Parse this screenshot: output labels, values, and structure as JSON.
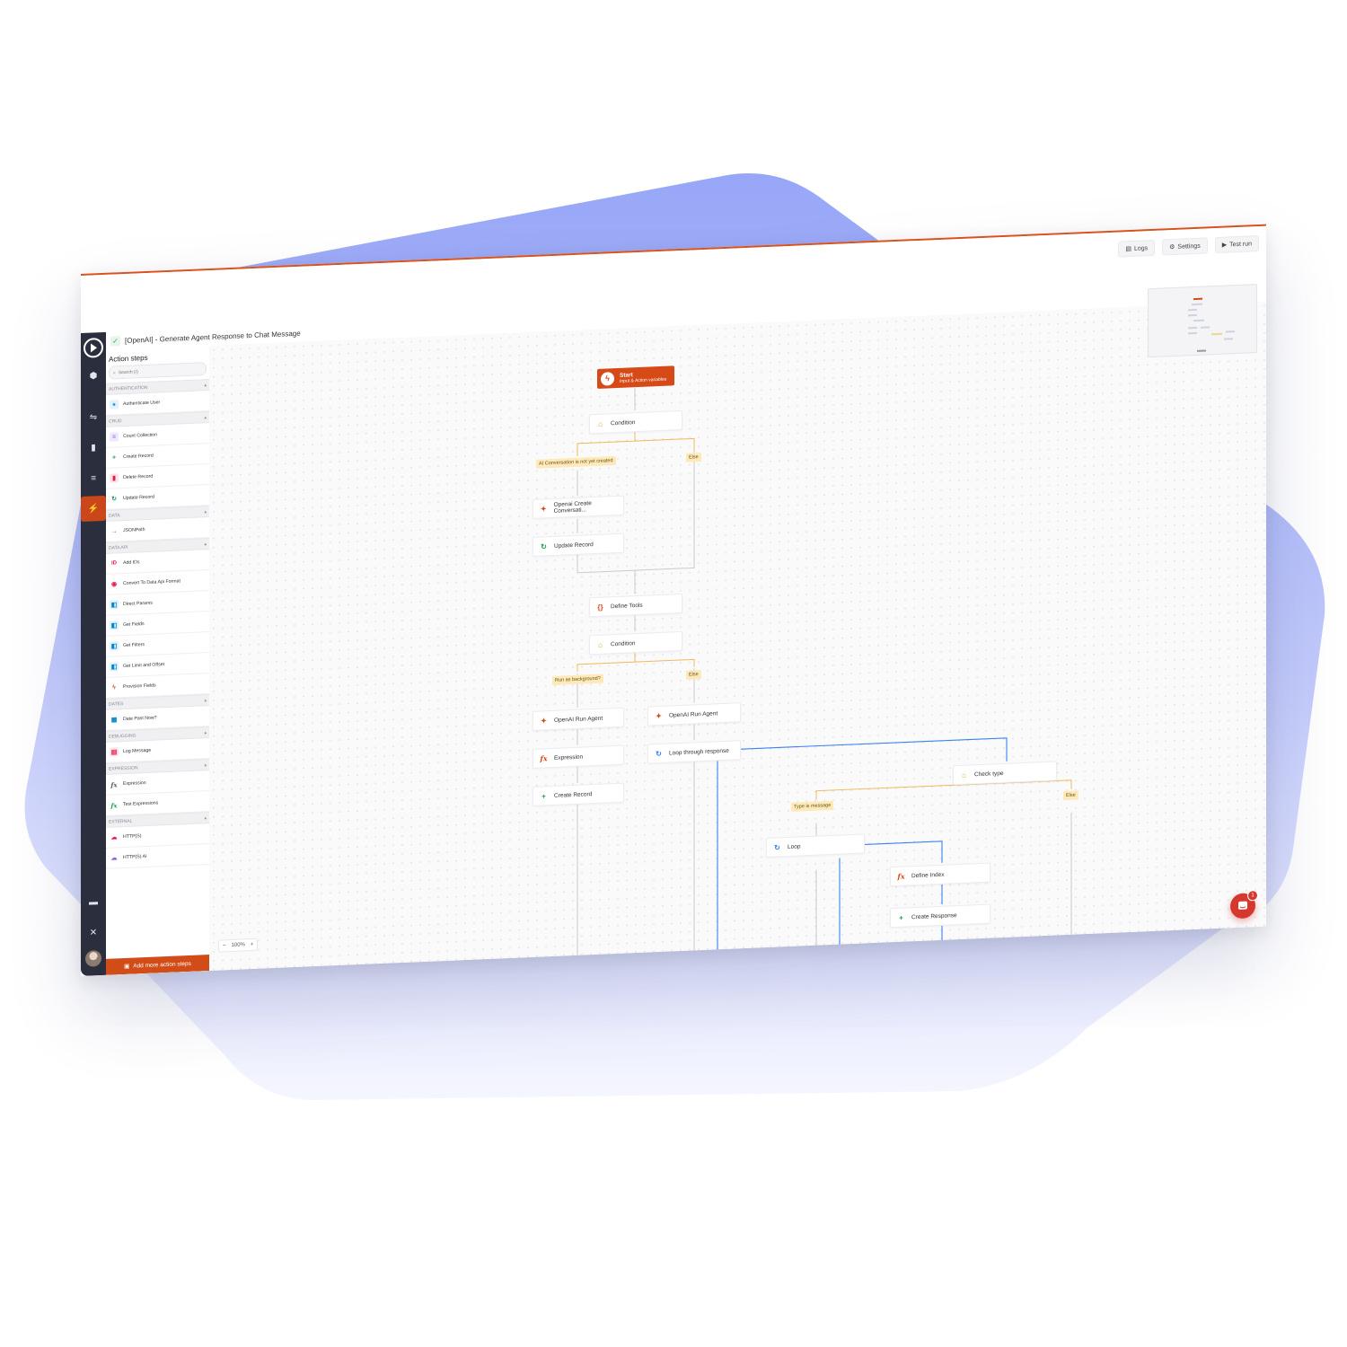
{
  "app": {
    "title": "[OpenAI] - Generate Agent Response to Chat Message",
    "status_check": "✓",
    "top_buttons": [
      {
        "icon": "logs-icon",
        "label": "Logs"
      },
      {
        "icon": "gear-icon",
        "label": "Settings"
      },
      {
        "icon": "play-icon",
        "label": "Test run"
      }
    ]
  },
  "sidebar": {
    "header": "Action steps",
    "search_placeholder": "Search (/)",
    "add_more_label": "Add more action steps",
    "categories": [
      {
        "name": "AUTHENTICATION",
        "items": [
          {
            "label": "Authenticate User",
            "icon": "user-icon",
            "color": "#2f9be0"
          }
        ]
      },
      {
        "name": "CRUD",
        "items": [
          {
            "label": "Count Collection",
            "icon": "database-icon",
            "color": "#8b5cf6"
          },
          {
            "label": "Create Record",
            "icon": "plus-icon",
            "color": "#1f9d55"
          },
          {
            "label": "Delete Record",
            "icon": "trash-icon",
            "color": "#e11d48"
          },
          {
            "label": "Update Record",
            "icon": "refresh-icon",
            "color": "#1f9d55"
          }
        ]
      },
      {
        "name": "DATA",
        "items": [
          {
            "label": "JSONPath",
            "icon": "arrow-right-icon",
            "color": "#7c3aed"
          }
        ]
      },
      {
        "name": "DATA API",
        "items": [
          {
            "label": "Add IDs",
            "icon": "id-icon",
            "color": "#e11d48"
          },
          {
            "label": "Convert To Data Api Format",
            "icon": "convert-icon",
            "color": "#e11d48"
          },
          {
            "label": "Direct Params",
            "icon": "params-icon",
            "color": "#0284c7"
          },
          {
            "label": "Get Fields",
            "icon": "params-icon",
            "color": "#0284c7"
          },
          {
            "label": "Get Filters",
            "icon": "params-icon",
            "color": "#0284c7"
          },
          {
            "label": "Get Limit and Offset",
            "icon": "params-icon",
            "color": "#0284c7"
          },
          {
            "label": "Provision Fields",
            "icon": "bolt-icon",
            "color": "#d54a17"
          }
        ]
      },
      {
        "name": "DATES",
        "items": [
          {
            "label": "Date Past Now?",
            "icon": "calendar-icon",
            "color": "#0284c7"
          }
        ]
      },
      {
        "name": "DEBUGGING",
        "items": [
          {
            "label": "Log Message",
            "icon": "log-icon",
            "color": "#e11d48"
          }
        ]
      },
      {
        "name": "EXPRESSION",
        "items": [
          {
            "label": "Expression",
            "icon": "fx-icon",
            "color": "#6b7280"
          },
          {
            "label": "Test Expressions",
            "icon": "fx-icon",
            "color": "#6b7280"
          }
        ]
      },
      {
        "name": "EXTERNAL",
        "items": [
          {
            "label": "HTTP(S)",
            "icon": "cloud-icon",
            "color": "#e11d48"
          },
          {
            "label": "HTTP(S) AI",
            "icon": "cloud-icon",
            "color": "#8b5cf6"
          }
        ]
      }
    ]
  },
  "canvas": {
    "zoom": "100%",
    "start": {
      "title": "Start",
      "subtitle": "Input & Action variables"
    },
    "nodes": {
      "condition1": "Condition",
      "openai_create": "Openai Create Conversati...",
      "update_record": "Update Record",
      "define_tools": "Define Tools",
      "condition2": "Condition",
      "run_agent_1": "OpenAI Run Agent",
      "expression": "Expression",
      "create_record": "Create Record",
      "run_agent_2": "OpenAI Run Agent",
      "loop_response": "Loop through response",
      "check_type": "Check type",
      "loop": "Loop",
      "define_index": "Define Index",
      "create_response": "Create Response"
    },
    "tags": {
      "ai_conv": "AI Conversation is not yet created",
      "else1": "Else",
      "run_bg": "Run as background?",
      "else2": "Else",
      "type_msg": "Type is message",
      "else3": "Else"
    }
  },
  "chat_widget": {
    "badge": "1"
  },
  "colors": {
    "accent": "#d54a17",
    "blob_top": "#97a6f7",
    "condition_tag": "#fde9b9",
    "wire_default": "#c9c9d1",
    "wire_condition": "#f0b95c",
    "wire_loop": "#3b82f6"
  }
}
